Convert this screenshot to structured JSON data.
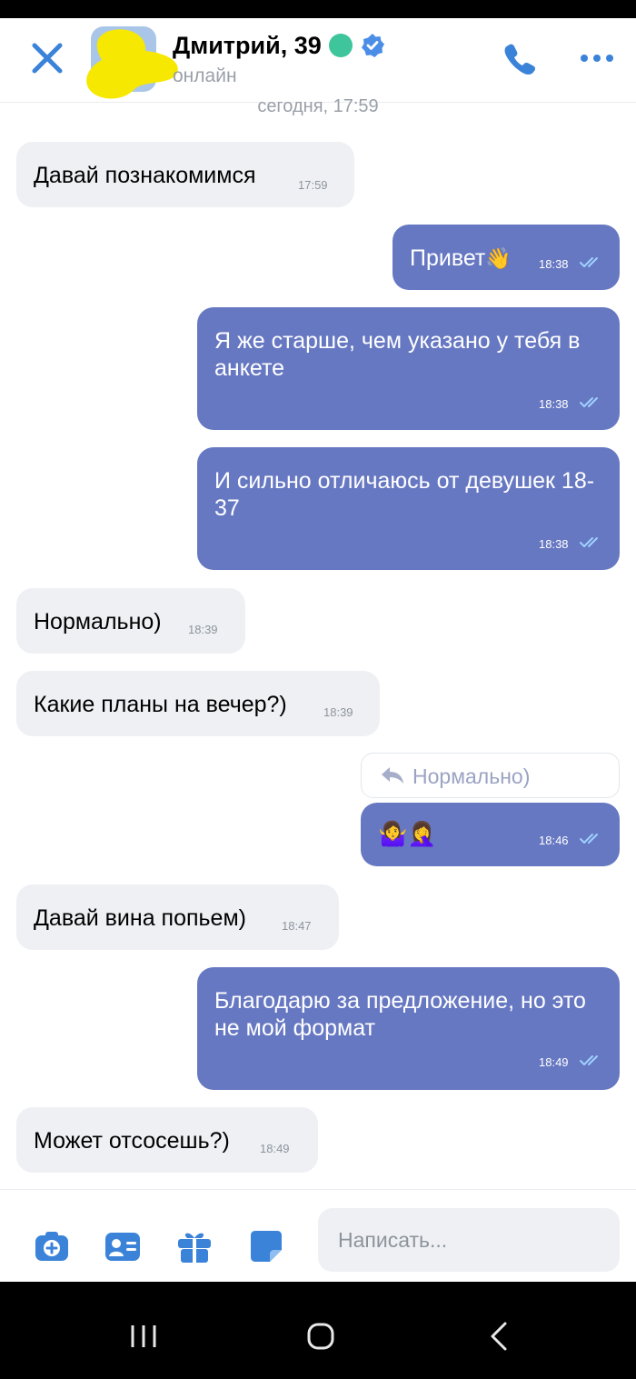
{
  "header": {
    "name": "Дмитрий, 39",
    "status": "онлайн"
  },
  "date_separator": "сегодня, 17:59",
  "messages": [
    {
      "dir": "in",
      "text": "Давай познакомимся",
      "time": "17:59"
    },
    {
      "dir": "out",
      "text": "Привет",
      "emoji": "👋",
      "time": "18:38"
    },
    {
      "dir": "out",
      "text": "Я же старше, чем указано у тебя в анкете",
      "time": "18:38"
    },
    {
      "dir": "out",
      "text": "И сильно отличаюсь от девушек 18-37",
      "time": "18:38"
    },
    {
      "dir": "in",
      "text": "Нормально)",
      "time": "18:39"
    },
    {
      "dir": "in",
      "text": "Какие планы на вечер?)",
      "time": "18:39"
    },
    {
      "dir": "out",
      "reply_to": "Нормально)",
      "text": "🤷‍♀️🤦‍♀️",
      "time": "18:46"
    },
    {
      "dir": "in",
      "text": "Давай вина попьем)",
      "time": "18:47"
    },
    {
      "dir": "out",
      "text": "Благодарю за предложение, но это не мой формат",
      "time": "18:49"
    },
    {
      "dir": "in",
      "text": "Может отсосешь?)",
      "time": "18:49"
    }
  ],
  "composer": {
    "placeholder": "Написать..."
  },
  "icons": {
    "close": "close-icon",
    "phone": "phone-icon",
    "more": "more-icon",
    "camera": "camera-plus-icon",
    "contact": "contact-card-icon",
    "gift": "gift-icon",
    "sticker": "sticker-icon",
    "verified": "verified-icon",
    "online": "online-dot"
  },
  "colors": {
    "accent": "#3a83d9",
    "outgoing_bubble": "#6778c2",
    "incoming_bubble": "#eef0f4",
    "online": "#3ec59b"
  }
}
